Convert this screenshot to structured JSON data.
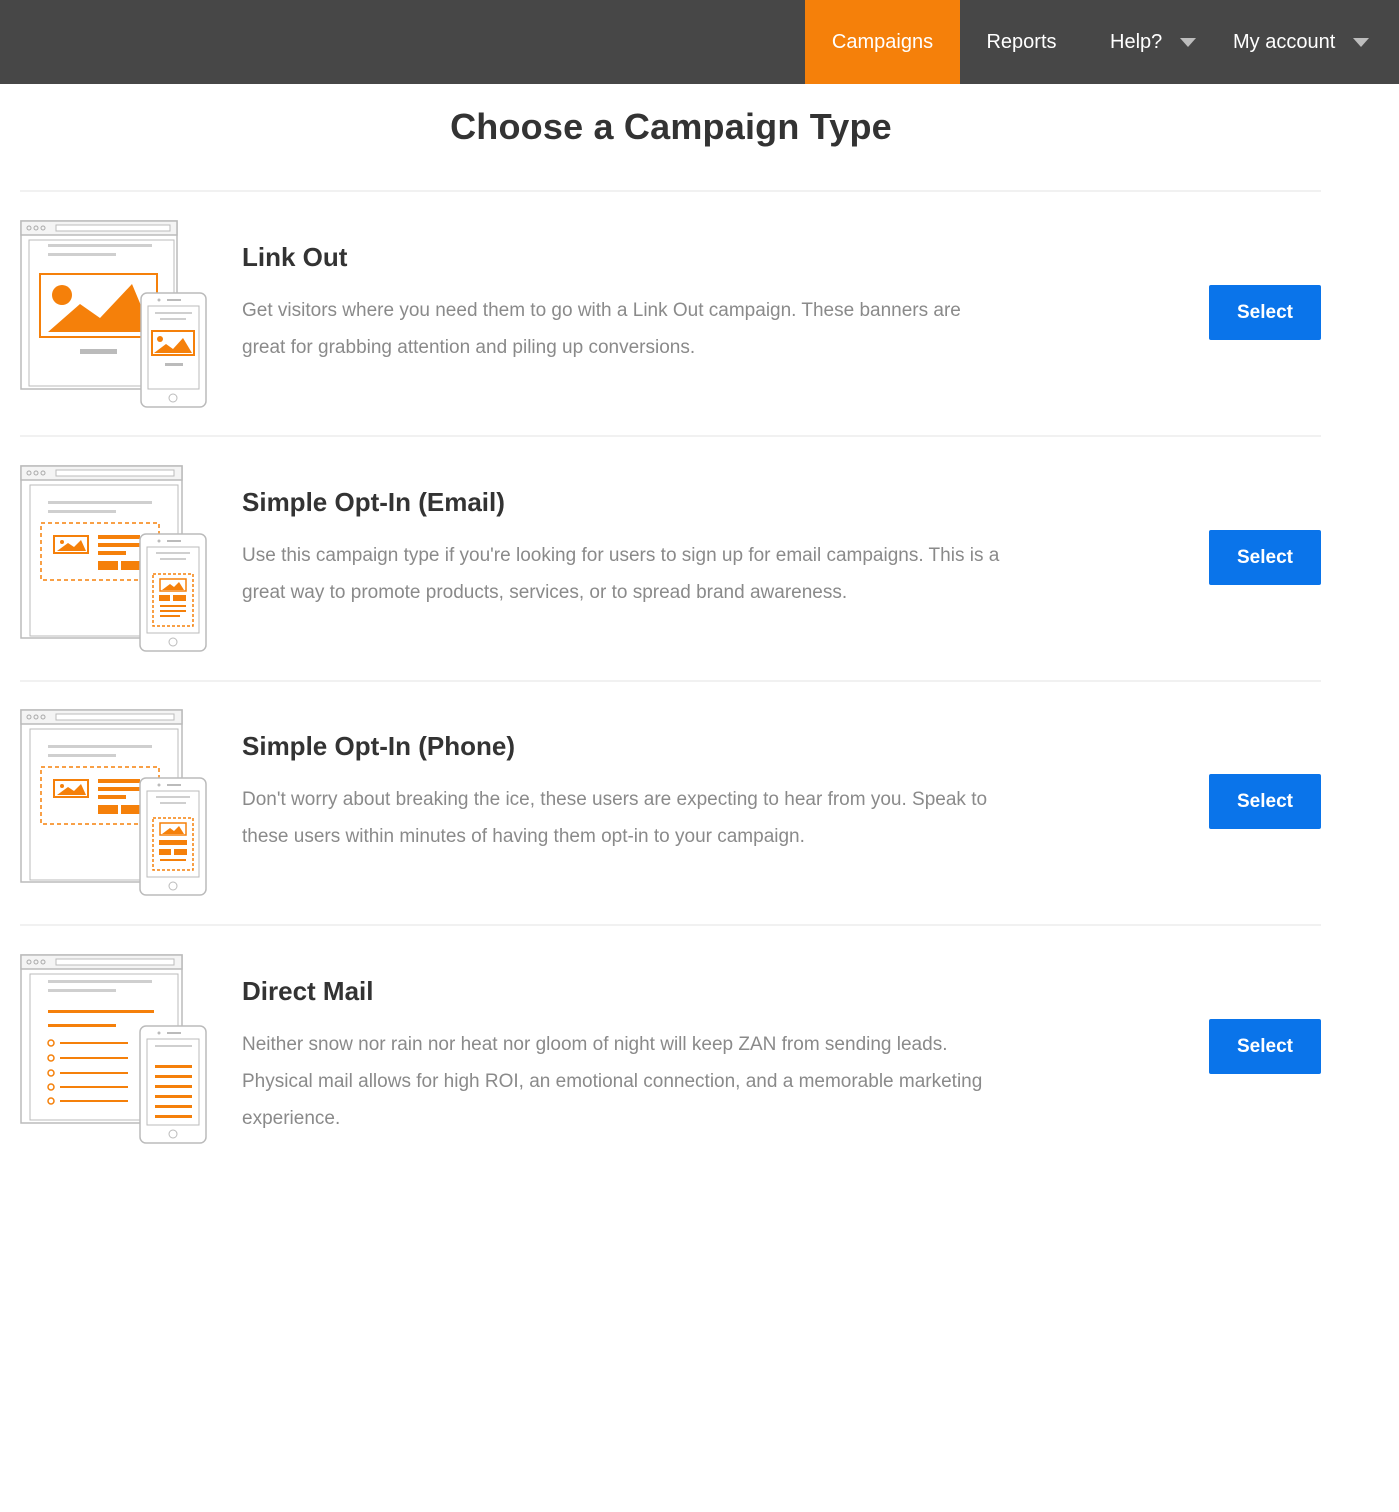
{
  "nav": {
    "campaigns": "Campaigns",
    "reports": "Reports",
    "help": "Help?",
    "account": "My account",
    "active_color": "#f5800a",
    "bar_color": "#474747"
  },
  "page": {
    "title": "Choose a Campaign Type"
  },
  "campaign_types": [
    {
      "title": "Link Out",
      "description": "Get visitors where you need them to go with a Link Out campaign. These banners are great for grabbing attention and piling up conversions.",
      "button": "Select",
      "icon": "link-out-illustration"
    },
    {
      "title": "Simple Opt-In (Email)",
      "description": "Use this campaign type if you're looking for users to sign up for email campaigns. This is a great way to promote products, services, or to spread brand awareness.",
      "button": "Select",
      "icon": "email-optin-illustration"
    },
    {
      "title": "Simple Opt-In (Phone)",
      "description": "Don't worry about breaking the ice, these users are expecting to hear from you. Speak to these users within minutes of having them opt-in to your campaign.",
      "button": "Select",
      "icon": "phone-optin-illustration"
    },
    {
      "title": "Direct Mail",
      "description": "Neither snow nor rain nor heat nor gloom of night will keep ZAN from sending leads. Physical mail allows for high ROI, an emotional connection, and a memorable marketing experience.",
      "button": "Select",
      "icon": "direct-mail-illustration"
    }
  ],
  "colors": {
    "accent": "#f5800a",
    "button": "#0a74ea",
    "text_muted": "#8a8a8a"
  }
}
